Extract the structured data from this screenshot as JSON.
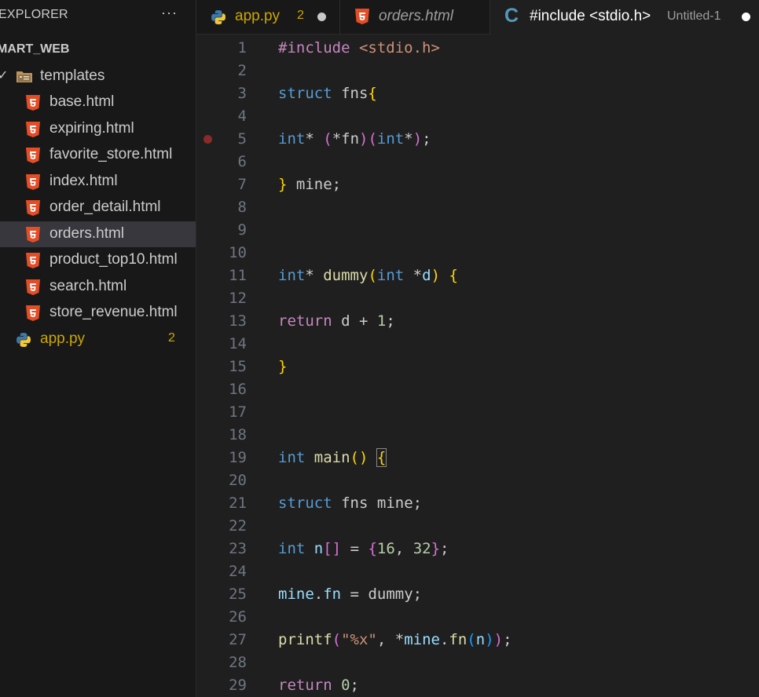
{
  "explorer": {
    "title": "EXPLORER",
    "more": "···",
    "project": "MART_WEB",
    "folder": {
      "chevron": "✓",
      "label": "templates",
      "icon": "folder-templates-icon"
    },
    "files": [
      "base.html",
      "expiring.html",
      "favorite_store.html",
      "index.html",
      "order_detail.html",
      "orders.html",
      "product_top10.html",
      "search.html",
      "store_revenue.html"
    ],
    "selected_file": "orders.html",
    "python_file": {
      "label": "app.py",
      "badge": "2"
    }
  },
  "tabs": [
    {
      "label": "app.py",
      "badge": "2",
      "icon": "python-icon",
      "modified": true
    },
    {
      "label": "orders.html",
      "icon": "html5-icon",
      "italic": true
    },
    {
      "label": "#include <stdio.h>",
      "description": "Untitled-1",
      "icon": "c-language-icon",
      "active": true,
      "modified": true
    }
  ],
  "editor": {
    "line_numbers": [
      "1",
      "2",
      "3",
      "4",
      "5",
      "6",
      "7",
      "8",
      "9",
      "10",
      "11",
      "12",
      "13",
      "14",
      "15",
      "16",
      "17",
      "18",
      "19",
      "20",
      "21",
      "22",
      "23",
      "24",
      "25",
      "26",
      "27",
      "28",
      "29"
    ],
    "breakpoint_line": "5",
    "tokens": {
      "l1_a": "#include",
      "l1_b": "<stdio.h>",
      "l3_a": "struct",
      "l3_b": "fns",
      "l3_c": "{",
      "l5_a": "int",
      "l5_b": "*",
      "l5_c": "(",
      "l5_d": "*fn",
      "l5_e": ")",
      "l5_f": "(",
      "l5_g": "int",
      "l5_h": "*",
      "l5_i": ")",
      "l5_j": ";",
      "l7_a": "}",
      "l7_b": "mine;",
      "l11_a": "int",
      "l11_b": "*",
      "l11_c": "dummy",
      "l11_d": "(",
      "l11_e": "int",
      "l11_f": "*",
      "l11_g": "d",
      "l11_h": ")",
      "l11_i": "{",
      "l13_a": "return",
      "l13_b": "d + ",
      "l13_c": "1",
      "l13_d": ";",
      "l15_a": "}",
      "l19_a": "int",
      "l19_b": "main",
      "l19_c": "()",
      "l19_d": "{",
      "l21_a": "struct",
      "l21_b": "fns",
      "l21_c": "mine;",
      "l23_a": "int",
      "l23_b": "n",
      "l23_c": "[]",
      "l23_d": " = ",
      "l23_e": "{",
      "l23_f": "16",
      "l23_g": ", ",
      "l23_h": "32",
      "l23_i": "}",
      "l23_j": ";",
      "l25_a": "mine",
      "l25_b": ".",
      "l25_c": "fn",
      "l25_d": " = ",
      "l25_e": "dummy;",
      "l27_a": "printf",
      "l27_b": "(",
      "l27_c": "\"%x\"",
      "l27_d": ", *",
      "l27_e": "mine",
      "l27_f": ".",
      "l27_g": "fn",
      "l27_h": "(",
      "l27_i": "n",
      "l27_j": ")",
      "l27_k": ")",
      "l27_l": ";",
      "l29_a": "return",
      "l29_b": "0",
      "l29_c": ";"
    }
  },
  "colors": {
    "background": "#1f1f1f",
    "sidebar": "#181818",
    "selection": "#37373d",
    "keyword": "#569cd6",
    "control": "#c586c0",
    "function": "#dcdcaa",
    "variable": "#9cdcfe",
    "number": "#b5cea8",
    "string": "#ce9178",
    "warning": "#cca700",
    "html_icon": "#e44d26",
    "c_icon": "#519aba"
  }
}
